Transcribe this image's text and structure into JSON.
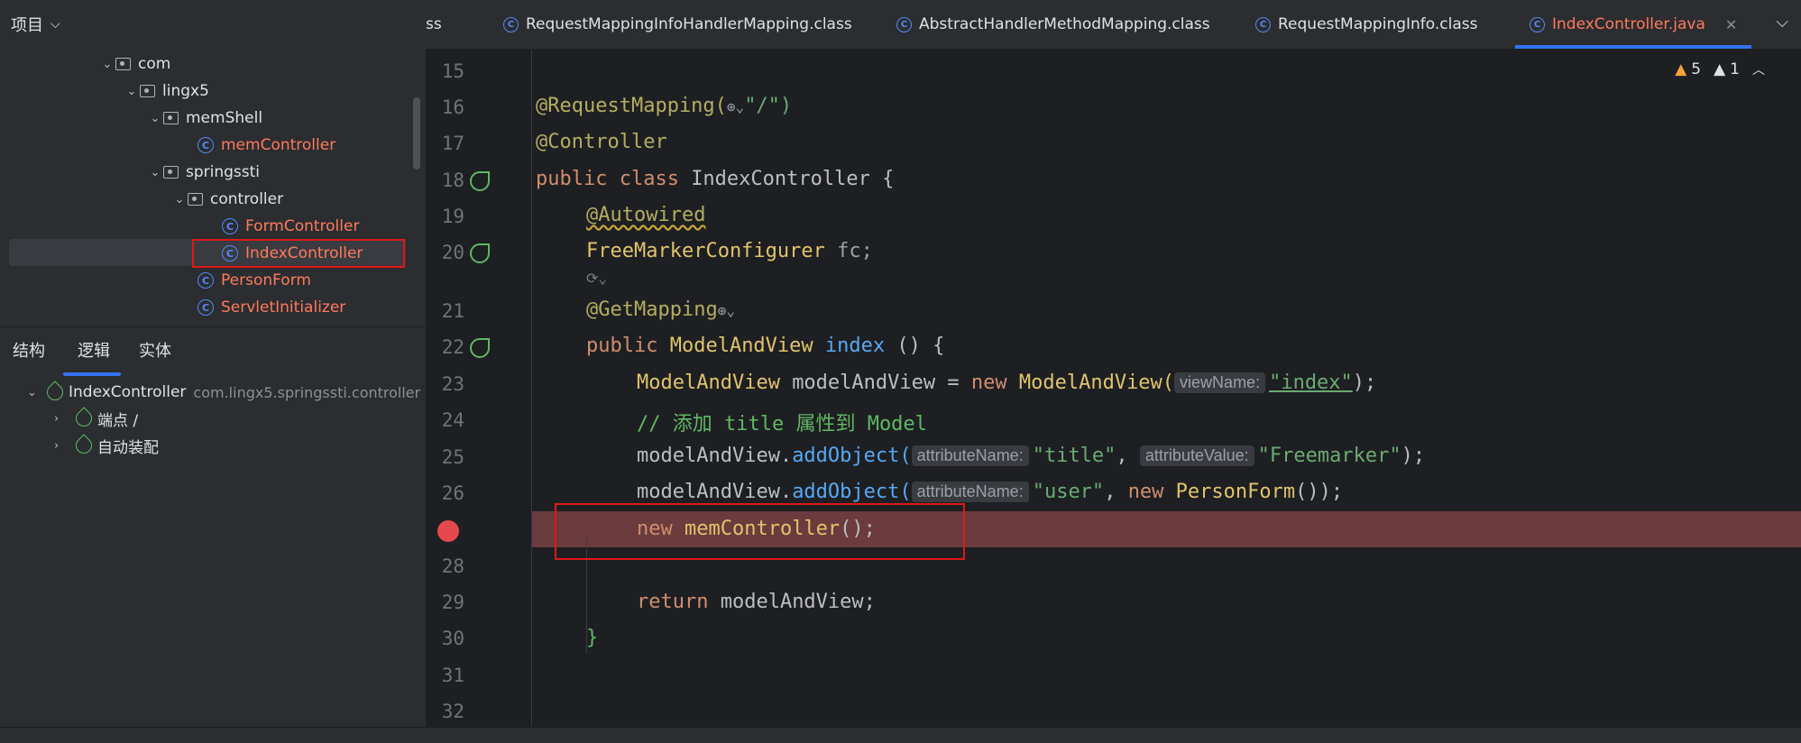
{
  "project_panel": {
    "title": "项目"
  },
  "tree": [
    {
      "label": "com",
      "kind": "folder"
    },
    {
      "label": "lingx5",
      "kind": "folder"
    },
    {
      "label": "memShell",
      "kind": "folder"
    },
    {
      "label": "memController",
      "kind": "class"
    },
    {
      "label": "springssti",
      "kind": "folder"
    },
    {
      "label": "controller",
      "kind": "folder"
    },
    {
      "label": "FormController",
      "kind": "class"
    },
    {
      "label": "IndexController",
      "kind": "class",
      "selected": true
    },
    {
      "label": "PersonForm",
      "kind": "class"
    },
    {
      "label": "ServletInitializer",
      "kind": "class"
    }
  ],
  "structure": {
    "tabs": [
      "结构",
      "逻辑",
      "实体"
    ],
    "active_tab": "逻辑",
    "root": {
      "label": "IndexController",
      "package": "com.lingx5.springssti.controller"
    },
    "children": [
      "端点 /",
      "自动装配"
    ]
  },
  "tabs": [
    {
      "label": "ss"
    },
    {
      "label": "RequestMappingInfoHandlerMapping.class"
    },
    {
      "label": "AbstractHandlerMethodMapping.class"
    },
    {
      "label": "RequestMappingInfo.class"
    },
    {
      "label": "IndexController.java",
      "active": true
    }
  ],
  "inspections": {
    "warnings": "5",
    "weak_warnings": "1"
  },
  "line_numbers": [
    "15",
    "16",
    "17",
    "18",
    "19",
    "20",
    "21",
    "22",
    "23",
    "24",
    "25",
    "26",
    "",
    "28",
    "29",
    "30",
    "31",
    "32"
  ],
  "code": {
    "l16_a": "@RequestMapping(",
    "l16_b": "\"/\")",
    "l17": "@Controller",
    "l18_kw": "public class ",
    "l18_rest": "IndexController {",
    "l19": "@Autowired",
    "l20_type": "FreeMarkerConfigurer ",
    "l20_rest": "fc;",
    "l21": "@GetMapping",
    "l22_kw": "public ",
    "l22_type": "ModelAndView ",
    "l22_fn": "index",
    "l22_rest": " () {",
    "l23_type": "ModelAndView ",
    "l23_var": "modelAndView = ",
    "l23_new": "new ",
    "l23_type2": "ModelAndView(",
    "l23_hint": "viewName:",
    "l23_str": "\"index\"",
    "l23_end": ");",
    "l24": "// 添加 title 属性到 Model",
    "l25_var": "modelAndView.",
    "l25_fn": "addObject(",
    "l25_hint1": "attributeName:",
    "l25_str1": "\"title\"",
    "l25_sep": ", ",
    "l25_hint2": "attributeValue:",
    "l25_str2": "\"Freemarker\"",
    "l25_end": ");",
    "l26_var": "modelAndView.",
    "l26_fn": "addObject(",
    "l26_hint": "attributeName:",
    "l26_str": "\"user\"",
    "l26_sep": ", ",
    "l26_new": "new ",
    "l26_type": "PersonForm",
    "l26_end": "());",
    "l27_new": "new ",
    "l27_type": "memController",
    "l27_end": "();",
    "l29_kw": "return ",
    "l29_rest": "modelAndView;",
    "l30": "}"
  },
  "colors": {
    "keyword": "#cf8e6d",
    "annotation": "#b3ae60",
    "string": "#6aab73",
    "function": "#56a8f5",
    "breakpoint_line": "#6b3b3e",
    "highlight_box": "#e01818"
  }
}
